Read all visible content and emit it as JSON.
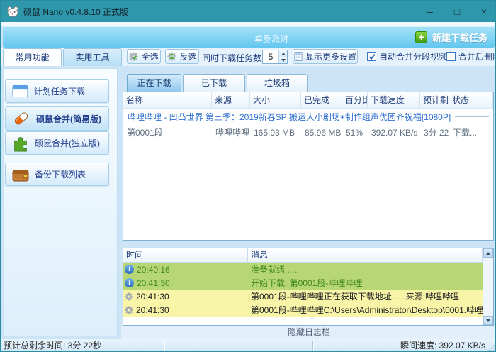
{
  "window": {
    "title": "硕鼠 Nano v0.4.8.10 正式版",
    "controls": {
      "minimize": "–",
      "maximize": "□",
      "close": "×"
    }
  },
  "banner": {
    "watermark": "单身派对",
    "new_task": "新建下载任务"
  },
  "toolbar": {
    "tabs": [
      {
        "label": "常用功能",
        "active": true
      },
      {
        "label": "实用工具",
        "active": false
      }
    ],
    "select_all": "全选",
    "invert_select": "反选",
    "concurrent_label": "同时下载任务数:",
    "concurrent_value": "5",
    "more_settings": "显示更多设置",
    "auto_merge": {
      "label": "自动合并分段视频",
      "checked": true
    },
    "delete_after_merge": {
      "label": "合并后删除原",
      "checked": false
    }
  },
  "sidebar": {
    "items": [
      {
        "label": "计划任务下载",
        "icon": "schedule-window-icon"
      },
      {
        "label": "硕鼠合并(简易版)",
        "icon": "capsule-icon"
      },
      {
        "label": "硕鼠合并(独立版)",
        "icon": "puzzle-icon"
      },
      {
        "label": "备份下载列表",
        "icon": "wallet-icon"
      }
    ]
  },
  "main": {
    "tabs": [
      {
        "label": "正在下载",
        "active": true
      },
      {
        "label": "已下载",
        "active": false
      },
      {
        "label": "垃圾箱",
        "active": false
      }
    ],
    "table": {
      "headers": [
        "名称",
        "来源",
        "大小",
        "已完成",
        "百分比",
        "下载速度",
        "预计剩...",
        "状态"
      ],
      "group_row": "哔哩哔哩 - 凹凸世界 第三季：2019新春SP 搬运人小剧场+制作组声优团齐祝福[1080P]",
      "rows": [
        [
          "第0001段",
          "哔哩哔哩",
          "165.93 MB",
          "85.96 MB",
          "51%",
          "392.07 KB/s",
          "3分 22...",
          "下载..."
        ]
      ]
    },
    "log": {
      "headers": [
        "时间",
        "消息"
      ],
      "rows": [
        {
          "time": "20:40:16",
          "message": "准备就绪......",
          "type": "info"
        },
        {
          "time": "20:41:30",
          "message": "开始下载: 第0001段-哔哩哔哩",
          "type": "info"
        },
        {
          "time": "20:41:30",
          "message": "第0001段-哔哩哔哩正在获取下载地址......来源:哔哩哔哩",
          "type": "working"
        },
        {
          "time": "20:41:30",
          "message": "第0001段-哔哩哔哩C:\\Users\\Administrator\\Desktop\\0001.哔哩...",
          "type": "working"
        }
      ]
    },
    "hide_log_label": "隐藏日志栏"
  },
  "statusbar": {
    "remaining_label": "预计总剩余时间:  3分 22秒",
    "speed_label": "瞬间速度: 392.07 KB/s"
  },
  "colors": {
    "titlebar": "#2e97ab",
    "banner_top": "#a7e2f9",
    "banner_bottom": "#63c7ee",
    "accent_green": "#4f9a10",
    "log_green_bg": "#b7d674",
    "log_yellow_bg": "#f8f4a8",
    "navy_text": "#1f3d7a"
  }
}
